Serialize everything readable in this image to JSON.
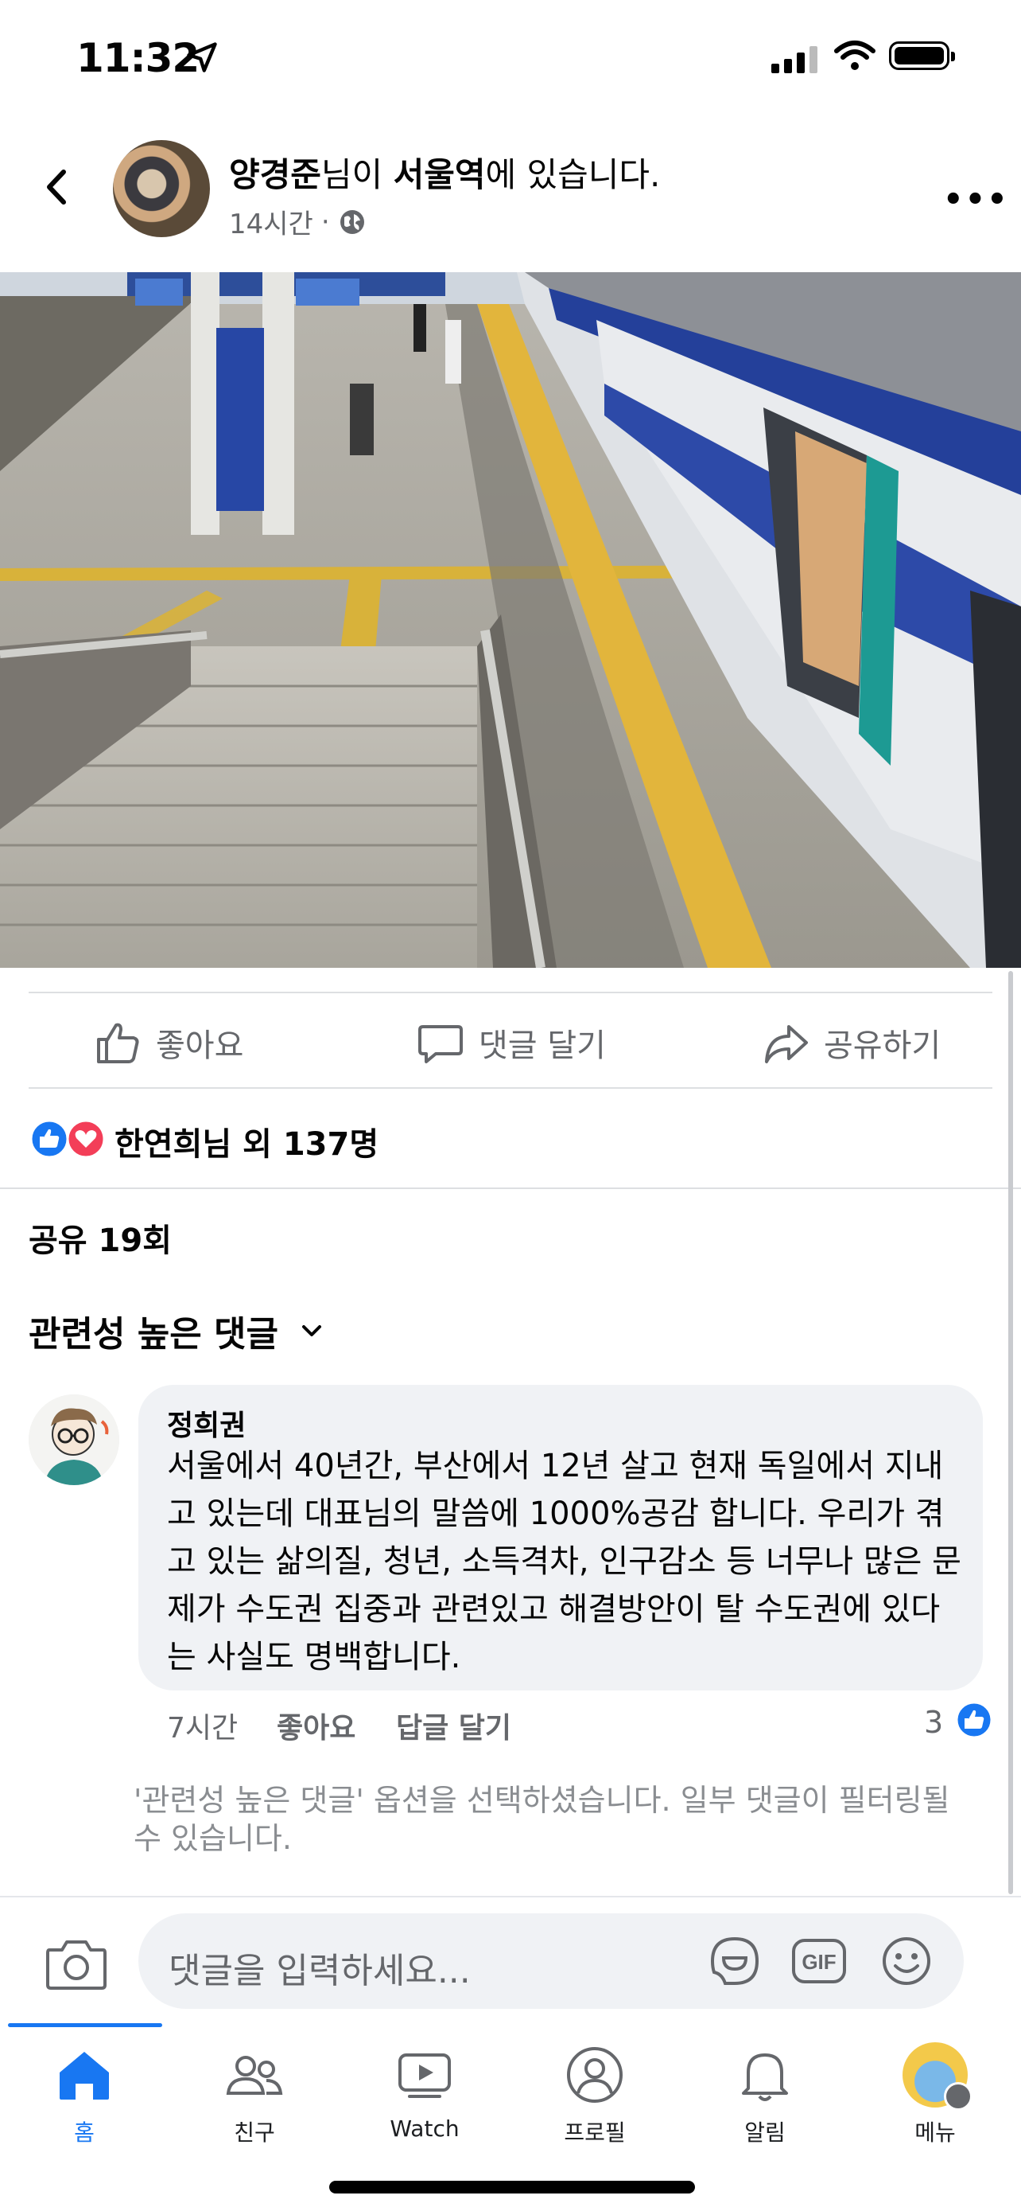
{
  "status_bar": {
    "time": "11:32"
  },
  "post": {
    "author": "양경준",
    "headline_mid": "님이 ",
    "location": "서울역",
    "headline_end": "에 있습니다.",
    "time": "14시간",
    "privacy_sep": "·"
  },
  "actions": {
    "like": "좋아요",
    "comment": "댓글 달기",
    "share": "공유하기"
  },
  "reactions": {
    "text": "한연희님 외 137명"
  },
  "shares": {
    "text": "공유 19회"
  },
  "comments_filter": {
    "label": "관련성 높은 댓글"
  },
  "comment": {
    "name": "정희권",
    "text": "서울에서 40년간, 부산에서 12년 살고 현재 독일에서 지내고 있는데 대표님의 말씀에 1000%공감 합니다. 우리가 겪고 있는 삶의질, 청년, 소득격차, 인구감소 등 너무나 많은 문제가 수도권 집중과 관련있고 해결방안이 탈 수도권에 있다는 사실도 명백합니다.",
    "time": "7시간",
    "like": "좋아요",
    "reply": "답글 달기",
    "like_count": "3"
  },
  "filter_note": "'관련성 높은 댓글' 옵션을 선택하셨습니다. 일부 댓글이 필터링될 수 있습니다.",
  "comment_input": {
    "placeholder": "댓글을 입력하세요..."
  },
  "nav": {
    "items": [
      {
        "label": "홈"
      },
      {
        "label": "친구"
      },
      {
        "label": "Watch"
      },
      {
        "label": "프로필"
      },
      {
        "label": "알림"
      },
      {
        "label": "메뉴"
      }
    ]
  },
  "colors": {
    "accent": "#1877f2",
    "love": "#f33e58",
    "secondary_text": "#65676b"
  }
}
